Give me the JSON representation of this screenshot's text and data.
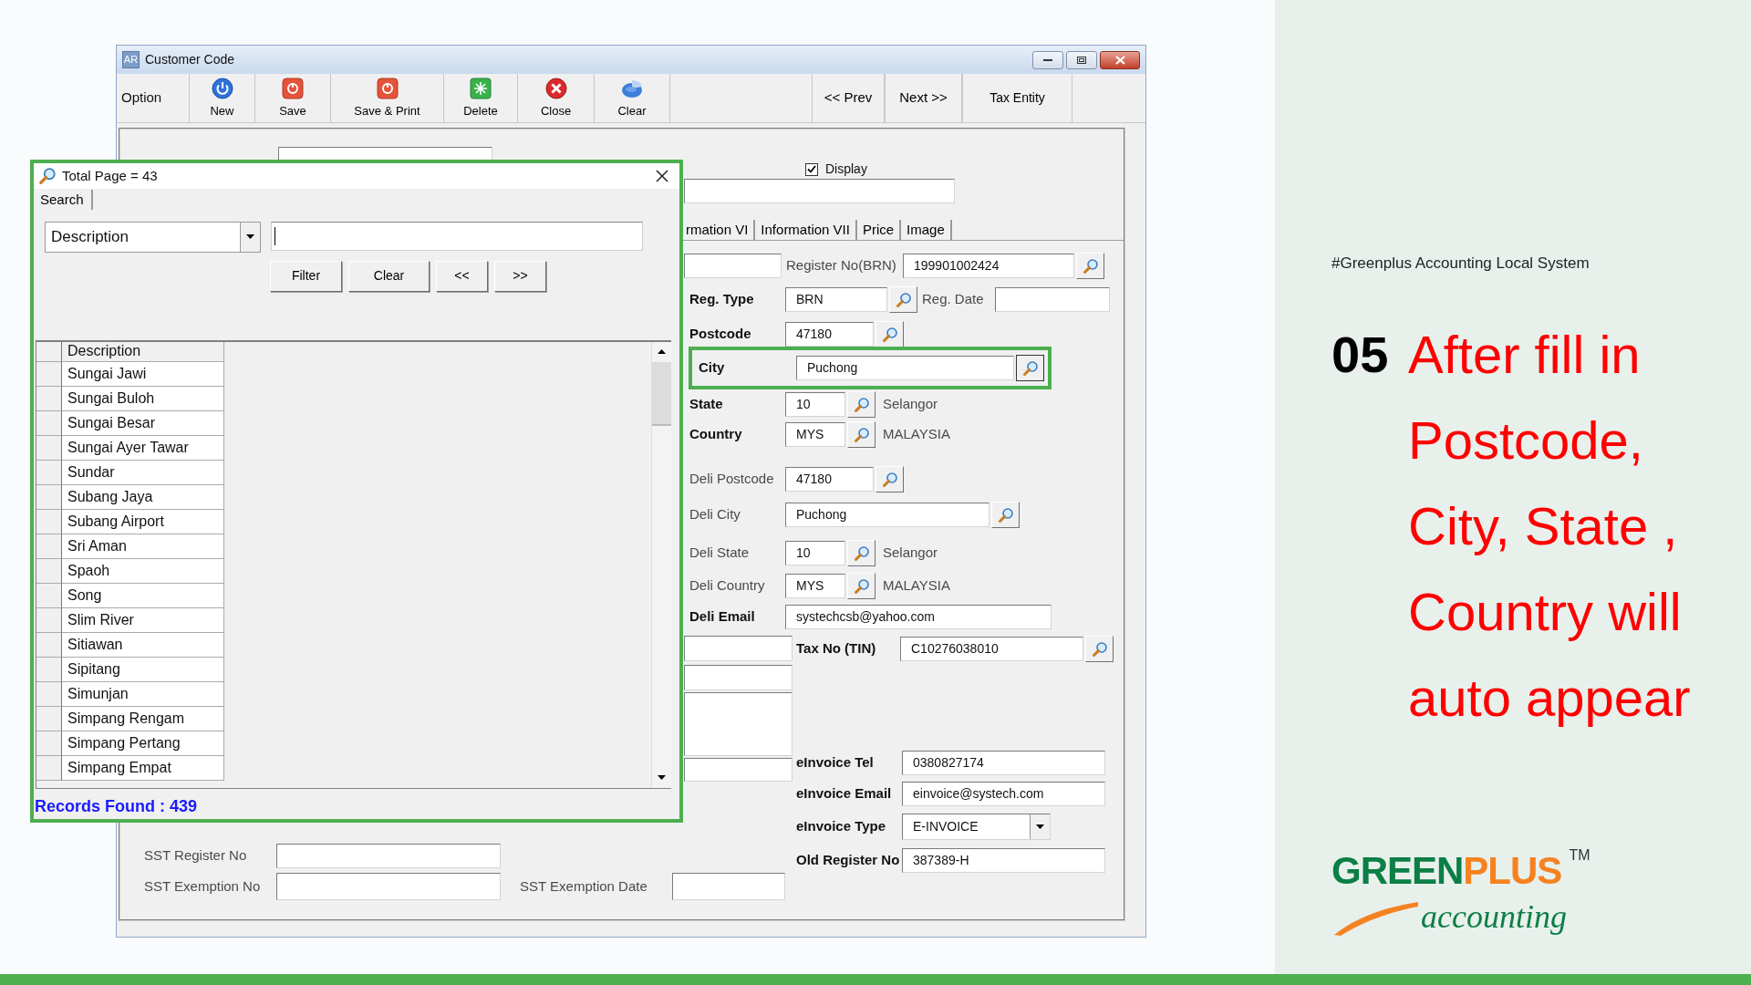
{
  "window": {
    "icon_text": "AR",
    "title": "Customer Code"
  },
  "toolbar": {
    "label": "Option",
    "actions": [
      {
        "kind": "new",
        "label": "New"
      },
      {
        "kind": "save",
        "label": "Save"
      },
      {
        "kind": "save_print",
        "label": "Save & Print"
      },
      {
        "kind": "delete",
        "label": "Delete"
      },
      {
        "kind": "close",
        "label": "Close"
      },
      {
        "kind": "clear",
        "label": "Clear"
      }
    ],
    "navigation": [
      "<< Prev",
      "Next >>",
      "Tax Entity"
    ]
  },
  "form": {
    "display": {
      "label": "Display",
      "checked": true
    },
    "tabs": [
      {
        "label": "rmation VI",
        "selected": false
      },
      {
        "label": "Information VII",
        "selected": false
      },
      {
        "label": "Price",
        "selected": false
      },
      {
        "label": "Image",
        "selected": false
      }
    ],
    "address_fields": [
      {
        "label": "Register No(BRN)",
        "value": "199901002424",
        "lookup": true,
        "emphasized": false,
        "highlighted": false
      },
      {
        "label": "Reg. Type",
        "value": "BRN",
        "lookup": true,
        "emphasized": true,
        "highlighted": false
      },
      {
        "label": "Reg. Date",
        "lookup": false,
        "emphasized": false,
        "highlighted": false
      },
      {
        "label": "Postcode",
        "value": "47180",
        "lookup": true,
        "emphasized": true,
        "highlighted": false
      },
      {
        "label": "City",
        "value": "Puchong",
        "lookup": true,
        "emphasized": true,
        "highlighted": true
      },
      {
        "label": "State",
        "value": "10",
        "lookup": true,
        "note": "Selangor",
        "emphasized": true,
        "highlighted": false
      },
      {
        "label": "Country",
        "value": "MYS",
        "lookup": true,
        "note": "MALAYSIA",
        "emphasized": true,
        "highlighted": false
      },
      {
        "label": "Deli Postcode",
        "value": "47180",
        "lookup": true,
        "emphasized": false,
        "highlighted": false
      },
      {
        "label": "Deli City",
        "value": "Puchong",
        "lookup": true,
        "emphasized": false,
        "highlighted": false
      },
      {
        "label": "Deli State",
        "value": "10",
        "lookup": true,
        "note": "Selangor",
        "emphasized": false,
        "highlighted": false
      },
      {
        "label": "Deli Country",
        "value": "MYS",
        "lookup": true,
        "note": "MALAYSIA",
        "emphasized": false,
        "highlighted": false
      },
      {
        "label": "Deli Email",
        "value": "systechcsb@yahoo.com",
        "lookup": false,
        "emphasized": true,
        "highlighted": false
      }
    ],
    "einvoice_fields": [
      {
        "kind": "text",
        "label": "Tax No (TIN)",
        "value": "C10276038010",
        "lookup": true
      },
      {
        "kind": "text",
        "label": "eInvoice Tel",
        "value": "0380827174",
        "lookup": false
      },
      {
        "kind": "text",
        "label": "eInvoice Email",
        "value": "einvoice@systech.com",
        "lookup": false
      },
      {
        "kind": "select",
        "label": "eInvoice Type",
        "value": "E-INVOICE",
        "lookup": false
      },
      {
        "kind": "text",
        "label": "Old Register No",
        "value": "387389-H",
        "lookup": false
      }
    ],
    "sst_fields": [
      {
        "label": "SST Register No"
      },
      {
        "label": "SST Exemption No"
      },
      {
        "label": "SST Exemption Date"
      }
    ]
  },
  "lookup_dialog": {
    "title": "Total Page = 43",
    "search_tab": "Search",
    "search_by": "Description",
    "buttons": [
      "Filter",
      "Clear",
      "<<",
      ">>"
    ],
    "column": "Description",
    "rows": [
      "Sungai Jawi",
      "Sungai Buloh",
      "Sungai Besar",
      "Sungai Ayer Tawar",
      "Sundar",
      "Subang Jaya",
      "Subang Airport",
      "Sri Aman",
      "Spaoh",
      "Song",
      "Slim River",
      "Sitiawan",
      "Sipitang",
      "Simunjan",
      "Simpang Rengam",
      "Simpang Pertang",
      "Simpang Empat"
    ],
    "status": "Records Found : 439"
  },
  "slide": {
    "tagline": "#Greenplus Accounting Local System",
    "step_number": "05",
    "step_text_lines": [
      "After fill in",
      "Postcode,",
      "City, State ,",
      "Country will",
      "auto appear"
    ],
    "logo": {
      "word_1": "GREEN",
      "word_2": "PLUS",
      "trademark": "TM",
      "subtitle": "accounting"
    }
  }
}
